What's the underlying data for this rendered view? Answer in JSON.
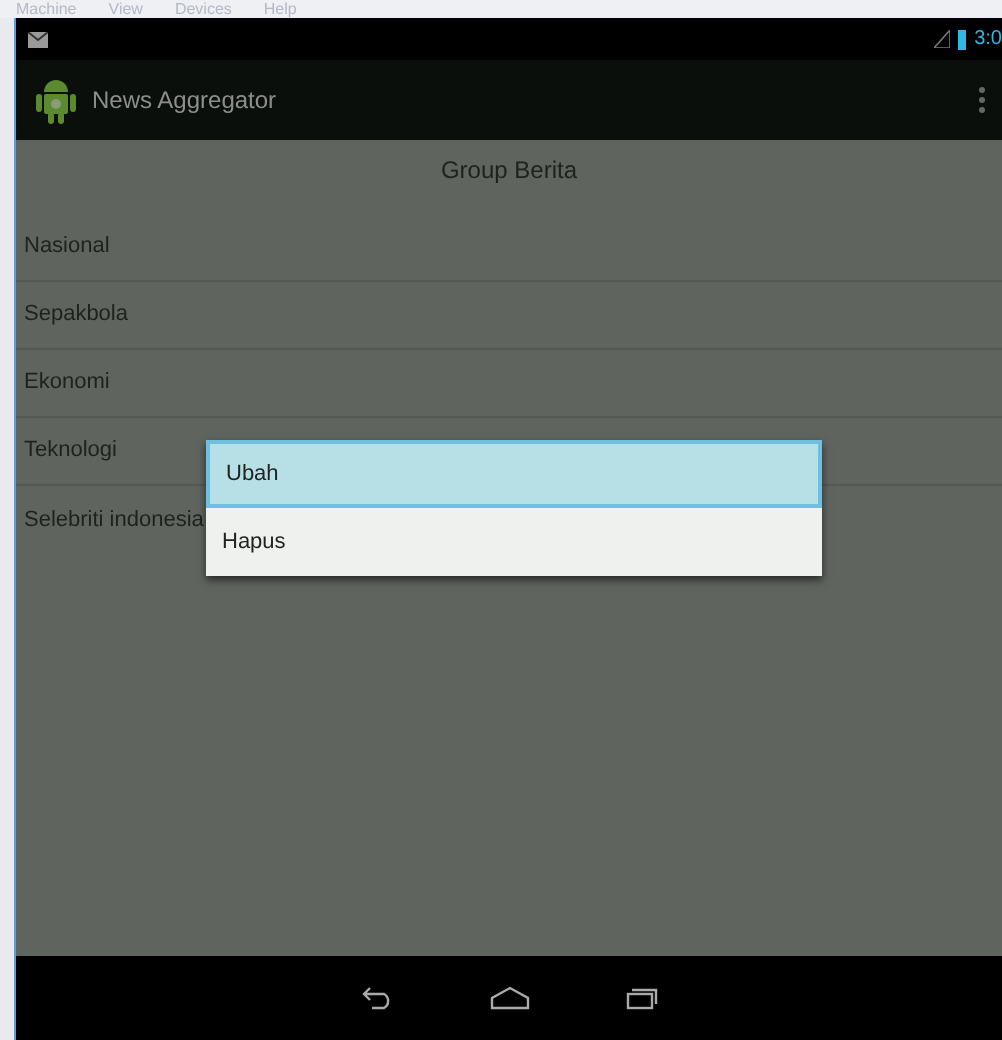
{
  "host_menu": [
    "Machine",
    "View",
    "Devices",
    "Help"
  ],
  "status_bar": {
    "time": "3:0"
  },
  "action_bar": {
    "title": "News Aggregator"
  },
  "list": {
    "title": "Group Berita",
    "items": [
      {
        "label": "Nasional"
      },
      {
        "label": "Sepakbola"
      },
      {
        "label": "Ekonomi"
      },
      {
        "label": "Teknologi"
      },
      {
        "label": "Selebriti indonesia"
      }
    ]
  },
  "context_menu": {
    "items": [
      {
        "label": "Ubah",
        "selected": true
      },
      {
        "label": "Hapus",
        "selected": false
      }
    ]
  }
}
